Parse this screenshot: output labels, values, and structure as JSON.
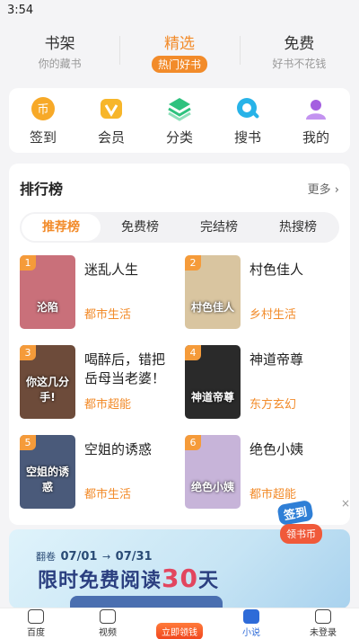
{
  "status": {
    "time": "3:54"
  },
  "top_tabs": [
    {
      "title": "书架",
      "sub": "你的藏书"
    },
    {
      "title": "精选",
      "sub": "热门好书"
    },
    {
      "title": "免费",
      "sub": "好书不花钱"
    }
  ],
  "quick": [
    {
      "label": "签到",
      "icon": "sign-in-icon",
      "color": "#f7a928"
    },
    {
      "label": "会员",
      "icon": "vip-icon",
      "color": "#f7b62a"
    },
    {
      "label": "分类",
      "icon": "category-icon",
      "color": "#2ec27e"
    },
    {
      "label": "搜书",
      "icon": "search-book-icon",
      "color": "#28b3e8"
    },
    {
      "label": "我的",
      "icon": "profile-icon",
      "color": "#a45fe0"
    }
  ],
  "ranking": {
    "title": "排行榜",
    "more": "更多",
    "tabs": [
      "推荐榜",
      "免费榜",
      "完结榜",
      "热搜榜"
    ],
    "books": [
      {
        "rank": "1",
        "title": "迷乱人生",
        "tag": "都市生活",
        "cover_text": "沦陷",
        "cover_color": "#c9707a"
      },
      {
        "rank": "2",
        "title": "村色佳人",
        "tag": "乡村生活",
        "cover_text": "村色佳人",
        "cover_color": "#d9c5a0"
      },
      {
        "rank": "3",
        "title": "喝醉后，错把岳母当老婆！",
        "tag": "都市超能",
        "cover_text": "你这几分手!",
        "cover_color": "#6d4b3a"
      },
      {
        "rank": "4",
        "title": "神道帝尊",
        "tag": "东方玄幻",
        "cover_text": "神道帝尊",
        "cover_color": "#2a2a2a"
      },
      {
        "rank": "5",
        "title": "空姐的诱惑",
        "tag": "都市生活",
        "cover_text": "空姐的诱惑",
        "cover_color": "#4a5a7a"
      },
      {
        "rank": "6",
        "title": "绝色小姨",
        "tag": "都市超能",
        "cover_text": "绝色小姨",
        "cover_color": "#c7b4d9"
      }
    ]
  },
  "signin_float": {
    "badge": "签到",
    "button": "领书币"
  },
  "banner": {
    "date_label": "翻卷",
    "date_from": "07/01",
    "date_to": "07/31",
    "headline_a": "限时免费阅读",
    "headline_num": "30",
    "headline_b": "天"
  },
  "tabbar": [
    {
      "label": "百度"
    },
    {
      "label": "视频"
    },
    {
      "label": "立即领钱"
    },
    {
      "label": "小说"
    },
    {
      "label": "未登录"
    }
  ]
}
